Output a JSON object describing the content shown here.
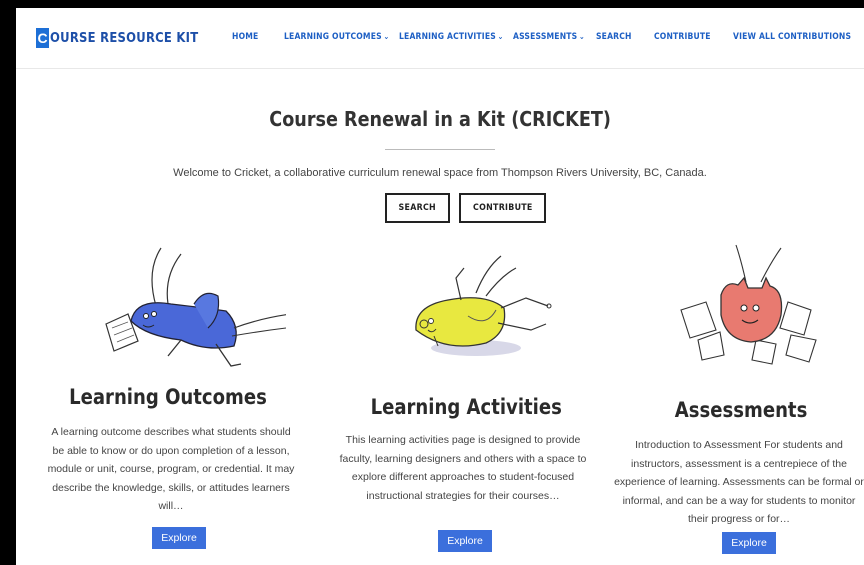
{
  "logo": {
    "mark": "C",
    "text": "OURSE RESOURCE KIT"
  },
  "nav": [
    {
      "label": "HOME",
      "dropdown": false
    },
    {
      "label": "LEARNING OUTCOMES",
      "dropdown": true
    },
    {
      "label": "LEARNING ACTIVITIES",
      "dropdown": true
    },
    {
      "label": "ASSESSMENTS",
      "dropdown": true
    },
    {
      "label": "SEARCH",
      "dropdown": false
    },
    {
      "label": "CONTRIBUTE",
      "dropdown": false
    },
    {
      "label": "VIEW ALL CONTRIBUTIONS",
      "dropdown": false
    }
  ],
  "nav_chevron": "⌄",
  "hero": {
    "title": "Course Renewal in a Kit (CRICKET)",
    "welcome": "Welcome to Cricket, a collaborative curriculum renewal space from Thompson Rivers University, BC, Canada.",
    "search_label": "SEARCH",
    "contribute_label": "CONTRIBUTE"
  },
  "columns": [
    {
      "title": "Learning Outcomes",
      "desc": "A learning outcome describes what students should be able to know or do upon completion of a lesson, module or unit, course, program, or credential. It may describe the knowledge, skills, or attitudes learners will…",
      "button": "Explore",
      "icon": "blue-cricket-icon"
    },
    {
      "title": "Learning Activities",
      "desc": "This learning activities page is designed to provide faculty, learning designers and others with a space to explore different approaches to student-focused instructional strategies for their courses…",
      "button": "Explore",
      "icon": "yellow-cricket-icon"
    },
    {
      "title": "Assessments",
      "desc": "Introduction to Assessment For students and instructors, assessment is a centrepiece of the experience of learning. Assessments can be formal or informal, and can be a way for students to monitor their progress or for…",
      "button": "Explore",
      "icon": "red-cricket-icon"
    }
  ],
  "colors": {
    "brand": "#1d4fa8",
    "nav": "#1d5fc4",
    "button": "#3b6fdc",
    "cricket_blue": "#4a68d8",
    "cricket_yellow": "#e8e840",
    "cricket_red": "#e87a70"
  }
}
